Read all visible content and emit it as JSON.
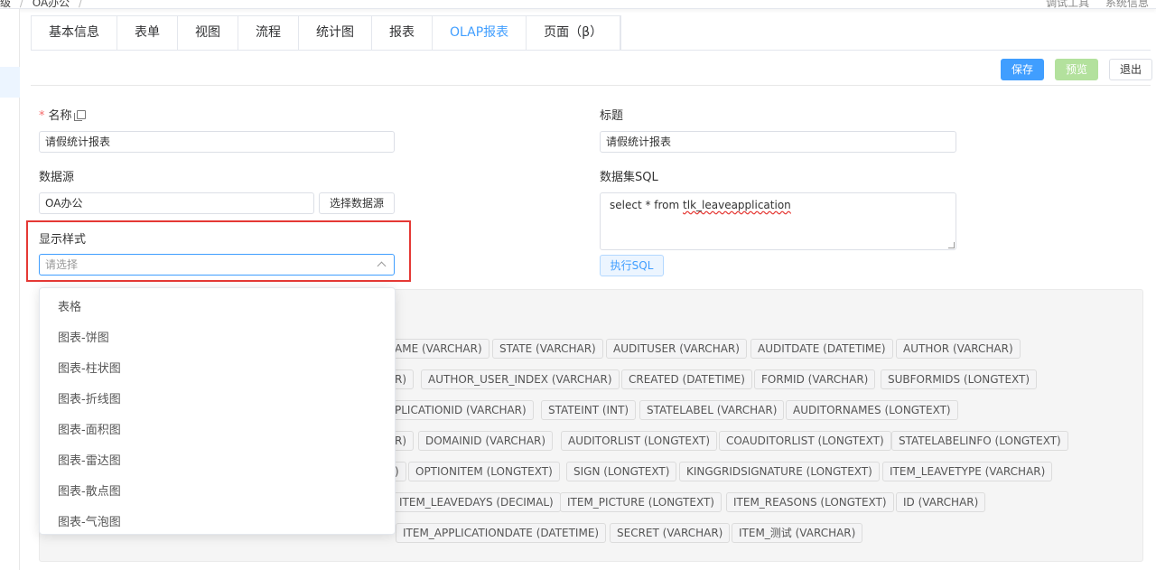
{
  "breadcrumb": {
    "root": "级",
    "sep": "/",
    "app": "OA办公",
    "trail": "/"
  },
  "top_tools": {
    "debug": "调试工具",
    "sysinfo": "系统信息"
  },
  "tabs": [
    {
      "label": "基本信息"
    },
    {
      "label": "表单"
    },
    {
      "label": "视图"
    },
    {
      "label": "流程"
    },
    {
      "label": "统计图"
    },
    {
      "label": "报表"
    },
    {
      "label": "OLAP报表"
    },
    {
      "label": "页面（β）"
    }
  ],
  "active_tab": "OLAP报表",
  "toolbar": {
    "save": "保存",
    "preview": "预览",
    "exit": "退出"
  },
  "form": {
    "name_label": "名称",
    "name_required": "*",
    "name_value": "请假统计报表",
    "title_label": "标题",
    "title_value": "请假统计报表",
    "datasource_label": "数据源",
    "datasource_value": "OA办公",
    "choose_datasource": "选择数据源",
    "dataset_sql_label": "数据集SQL",
    "sql_prefix": "select * from ",
    "sql_table": "tlk_leaveapplication",
    "run_sql": "执行SQL",
    "display_style_label": "显示样式",
    "display_style_placeholder": "请选择"
  },
  "dropdown_options": [
    "表格",
    "图表-饼图",
    "图表-柱状图",
    "图表-折线图",
    "图表-面积图",
    "图表-雷达图",
    "图表-散点图",
    "图表-气泡图"
  ],
  "fields": {
    "row1": [
      "AME (VARCHAR)",
      "STATE (VARCHAR)",
      "AUDITUSER (VARCHAR)",
      "AUDITDATE (DATETIME)",
      "AUTHOR (VARCHAR)"
    ],
    "row2": [
      "R)",
      "AUTHOR_USER_INDEX (VARCHAR)",
      "CREATED (DATETIME)",
      "FORMID (VARCHAR)",
      "SUBFORMIDS (LONGTEXT)"
    ],
    "row3": [
      "PLICATIONID (VARCHAR)",
      "STATEINT (INT)",
      "STATELABEL (VARCHAR)",
      "AUDITORNAMES (LONGTEXT)"
    ],
    "row4": [
      "R)",
      "DOMAINID (VARCHAR)",
      "AUDITORLIST (LONGTEXT)",
      "COAUDITORLIST (LONGTEXT)",
      "STATELABELINFO (LONGTEXT)"
    ],
    "row5": [
      ")",
      "OPTIONITEM (LONGTEXT)",
      "SIGN (LONGTEXT)",
      "KINGGRIDSIGNATURE (LONGTEXT)",
      "ITEM_LEAVETYPE (VARCHAR)"
    ],
    "row6": [
      "ITEM_LEAVEDAYS (DECIMAL)",
      "ITEM_PICTURE (LONGTEXT)",
      "ITEM_REASONS (LONGTEXT)",
      "ID (VARCHAR)"
    ],
    "row7": [
      "ITEM_APPLICATIONDATE (DATETIME)",
      "SECRET (VARCHAR)",
      "ITEM_测试 (VARCHAR)"
    ]
  }
}
